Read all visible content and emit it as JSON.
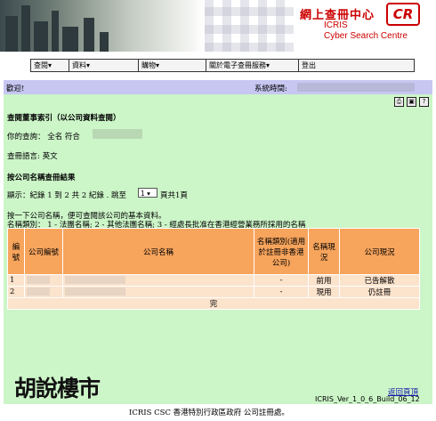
{
  "banner": {
    "title_cn": "網上查冊中心",
    "logo": "CR",
    "title_icris": "ICRIS",
    "title_en": "Cyber Search Centre"
  },
  "menu": {
    "items": [
      {
        "label": "查閱▾"
      },
      {
        "label": "資料▾"
      },
      {
        "label": "購物▾"
      },
      {
        "label": "關於電子查冊服務▾"
      },
      {
        "label": "登出"
      }
    ]
  },
  "header": {
    "welcome": "歡迎!",
    "systime_label": "系統時間:"
  },
  "toolbar": {
    "print_icon": "print-icon",
    "save_icon": "save-icon",
    "help_icon": "help-icon"
  },
  "main": {
    "page_title": "查閱董事索引（以公司資料查閱）",
    "query_label": "你的查詢： 全名 符合",
    "language_line": "查冊語言: 英文",
    "section_title": "按公司名稱查冊結果",
    "display_text": "顯示：紀錄 1 到 2 共 2 紀錄 . 跳至",
    "page_select_value": "1",
    "page_tail": "頁共1頁",
    "instruction_1": "按一下公司名稱，便可查閱該公司的基本資料。",
    "instruction_2": "名稱類別： 1 - 法團名稱; 2 - 其他法團名稱; 3 - 經處長批准在香港經營業務所採用的名稱",
    "table": {
      "headers": [
        "編號",
        "公司編號",
        "公司名稱",
        "名稱類別(適用於註冊非香港公司)",
        "名稱現況",
        "公司現況"
      ],
      "rows": [
        {
          "no": "1",
          "category": "-",
          "name_status": "前用",
          "company_status": "已告解散"
        },
        {
          "no": "2",
          "category": "-",
          "name_status": "現用",
          "company_status": "仍註冊"
        }
      ],
      "end_label": "完"
    },
    "back_link": "返回頁頂",
    "version": "ICRIS_Ver_1_0_6_Build_06_12"
  },
  "watermark": "胡說樓市",
  "footer": "ICRIS CSC 香港特別行政區政府 公司註冊處。",
  "colors": {
    "banner_red": "#cc0000",
    "header_bar": "#c7c7f2",
    "main_bg": "#ccf5c8",
    "table_header": "#f7a45c",
    "table_row": "#fbe3cc"
  }
}
